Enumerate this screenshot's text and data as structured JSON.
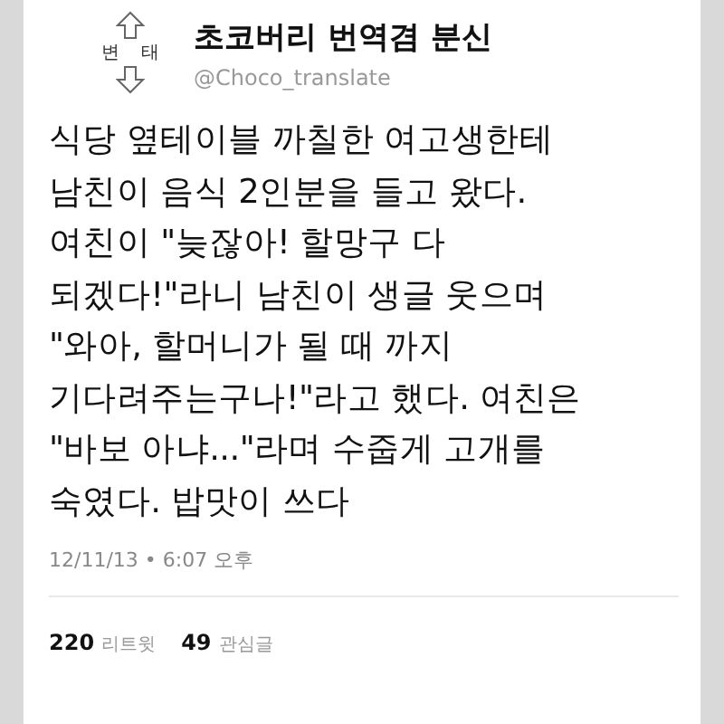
{
  "avatar": {
    "top_label": "변",
    "bottom_label": "태"
  },
  "author": {
    "name": "초코버리 번역겸 분신",
    "handle": "@Choco_translate"
  },
  "tweet": {
    "text": "식당 옆테이블 까칠한 여고생한테\n남친이 음식 2인분을 들고 왔다.\n여친이 \"늦잖아! 할망구 다\n되겠다!\"라니 남친이 생글 웃으며\n\"와아, 할머니가 될 때 까지\n기다려주는구나!\"라고 했다. 여친은\n\"바보 아냐...\"라며 수줍게 고개를\n숙였다. 밥맛이 쓰다",
    "timestamp": "12/11/13 • 6:07 오후"
  },
  "stats": [
    {
      "count": "220",
      "label": "리트윗"
    },
    {
      "count": "49",
      "label": "관심글"
    }
  ]
}
